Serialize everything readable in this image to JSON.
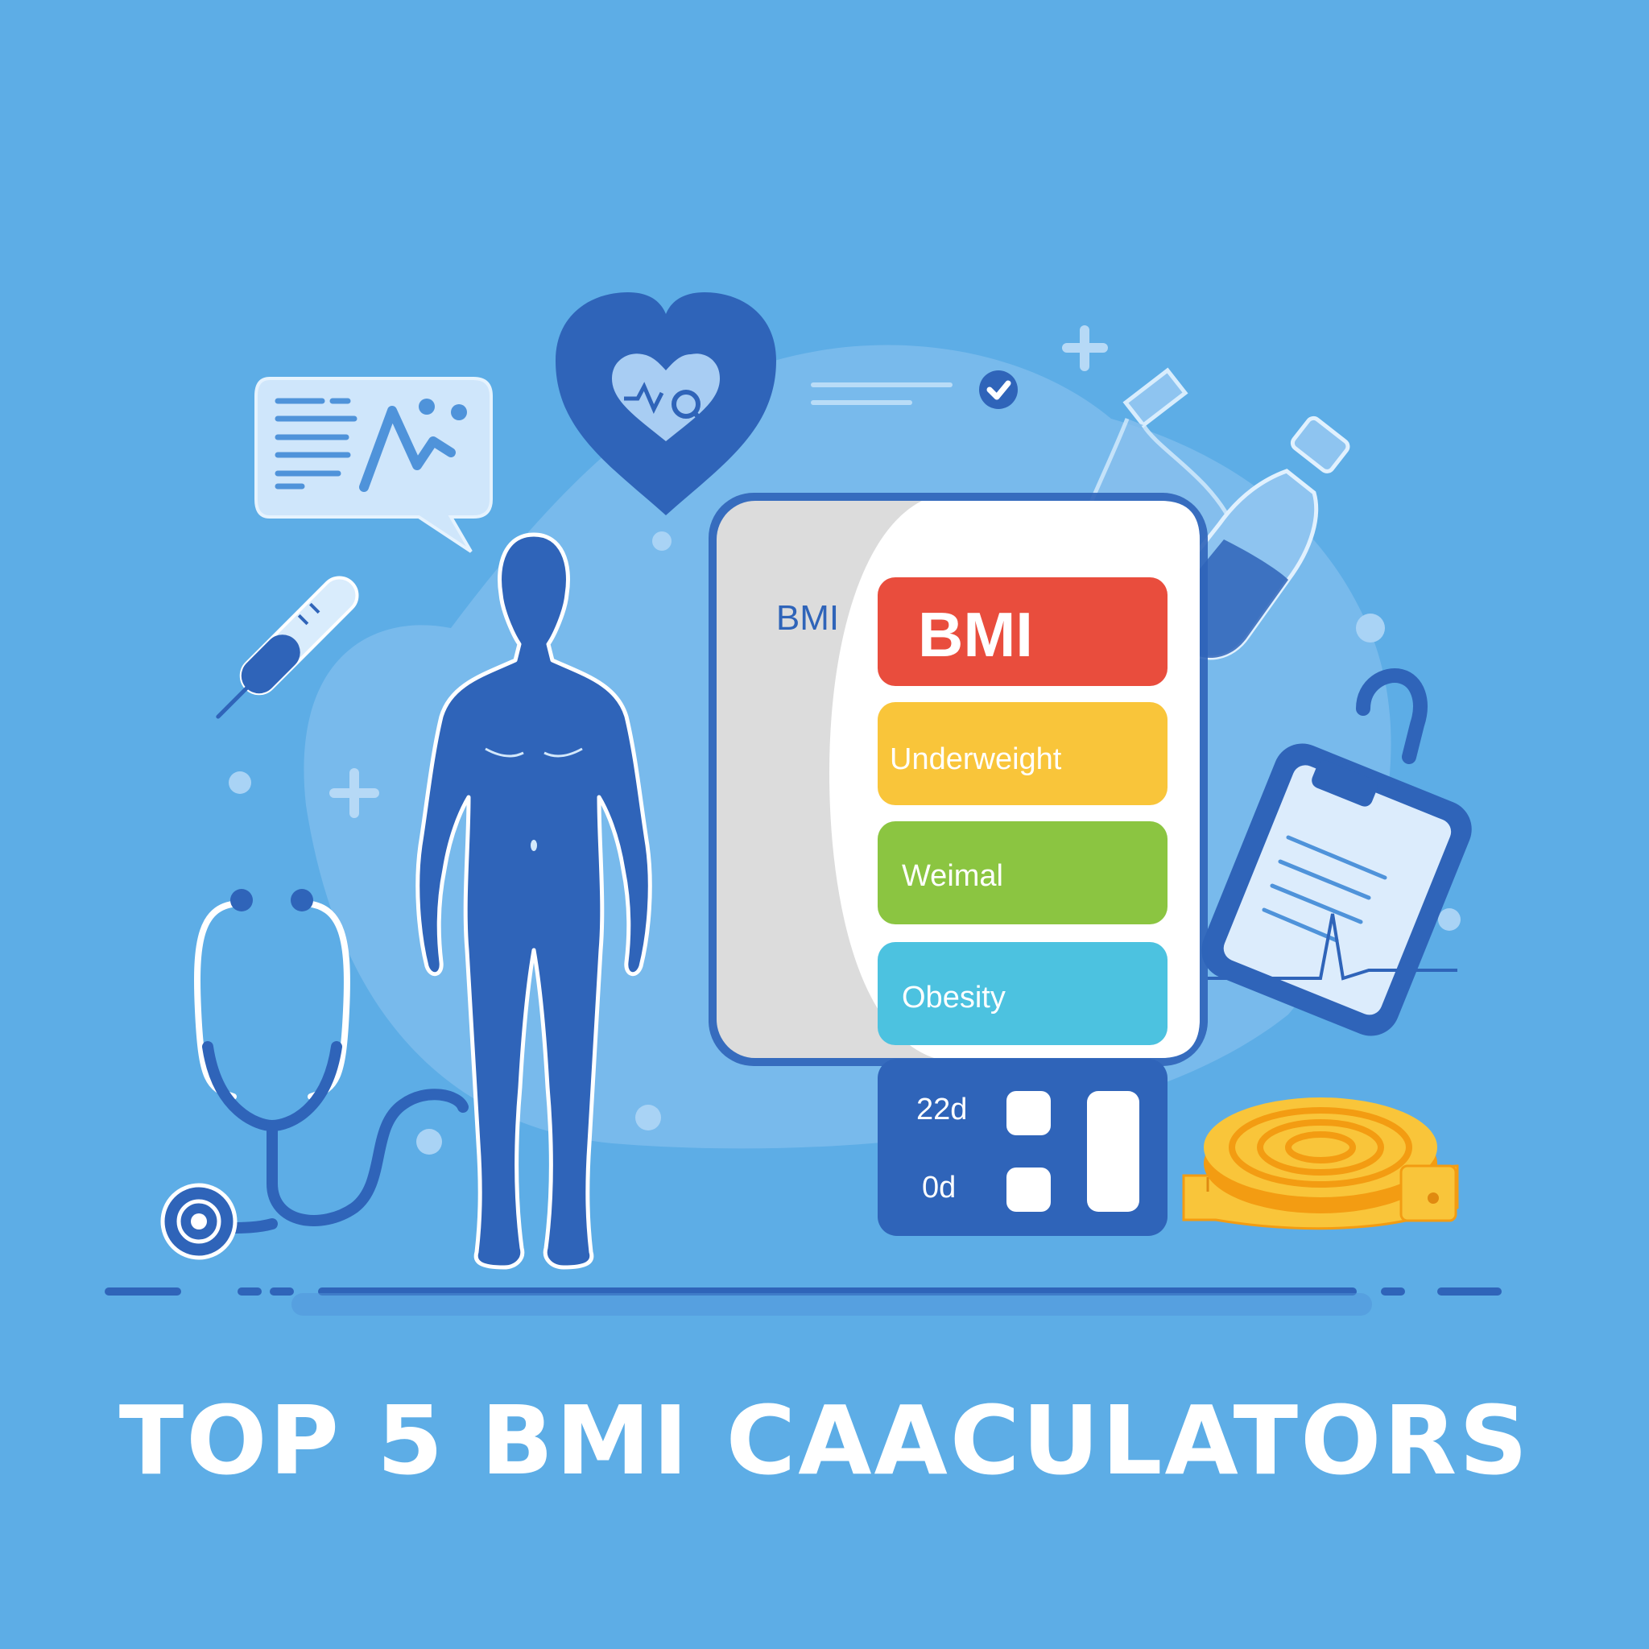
{
  "poster": {
    "title": "TOP 5 BMI CAACULATORS"
  },
  "phone": {
    "side_label": "BMI",
    "header": "BMI",
    "categories": [
      {
        "label": "Underweight",
        "color": "#f9c53a"
      },
      {
        "label": "Weimal",
        "color": "#8bc541"
      },
      {
        "label": "Obesity",
        "color": "#4cc2e0"
      }
    ],
    "header_color": "#e94d3d",
    "bottom_panel": {
      "value_1": "22d",
      "value_2": "0d"
    }
  },
  "colors": {
    "background": "#5dade6",
    "accent_blue": "#2f64b9",
    "title": "#ffffff"
  },
  "icons": [
    "heart-monitor-icon",
    "chat-chart-icon",
    "thermometer-icon",
    "stethoscope-icon",
    "human-figure-icon",
    "bottle-icon",
    "clipboard-icon",
    "measuring-tape-icon",
    "plus-icon",
    "check-icon"
  ]
}
